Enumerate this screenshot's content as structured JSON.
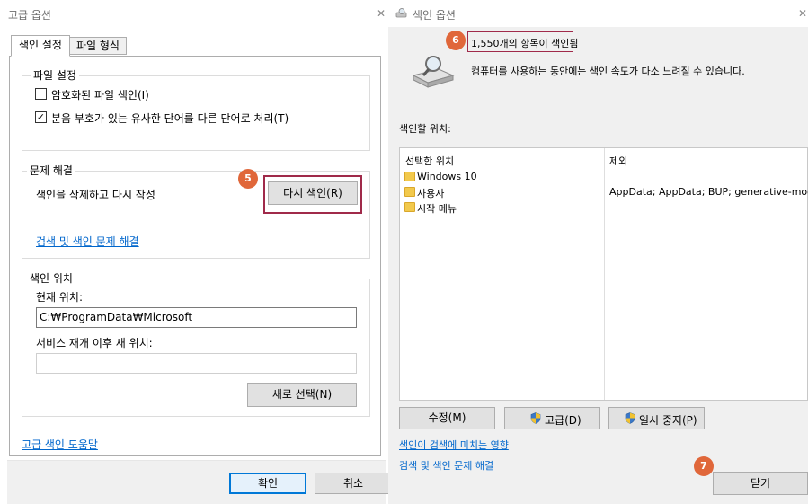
{
  "left": {
    "title": "고급 옵션",
    "tabs": [
      {
        "label": "색인 설정"
      },
      {
        "label": "파일 형식"
      }
    ],
    "file_settings": {
      "legend": "파일 설정",
      "options": [
        {
          "label": "암호화된 파일 색인(I)",
          "checked": false
        },
        {
          "label": "분음 부호가 있는 유사한 단어를 다른 단어로 처리(T)",
          "checked": true
        }
      ]
    },
    "troubleshooting": {
      "legend": "문제 해결",
      "rebuild_text": "색인을 삭제하고 다시 작성",
      "rebuild_button": "다시 색인(R)",
      "link": "검색 및 색인 문제 해결"
    },
    "index_location": {
      "legend": "색인 위치",
      "current_label": "현재 위치:",
      "current_value": "C:₩ProgramData₩Microsoft",
      "new_label": "서비스 재개 이후 새 위치:",
      "new_value": "",
      "select_button": "새로 선택(N)"
    },
    "help_link": "고급 색인 도움말",
    "ok_button": "확인",
    "cancel_button": "취소",
    "callout": "5"
  },
  "right": {
    "title": "색인 옵션",
    "status": "1,550개의 항목이 색인됨",
    "status_note": "컴퓨터를 사용하는 동안에는 색인 속도가 다소 느려질 수 있습니다.",
    "locations_label": "색인할 위치:",
    "col_included": "선택한 위치",
    "col_excluded": "제외",
    "locations": [
      {
        "name": "Windows 10"
      },
      {
        "name": "사용자"
      },
      {
        "name": "시작 메뉴"
      }
    ],
    "exclusions": [
      {
        "text": ""
      },
      {
        "text": "AppData; AppData; BUP; generative-models"
      },
      {
        "text": ""
      }
    ],
    "modify_button": "수정(M)",
    "advanced_button": "고급(D)",
    "pause_button": "일시 중지(P)",
    "link_effect": "색인이 검색에 미치는 영향",
    "link_troubleshoot": "검색 및 색인 문제 해결",
    "close_button": "닫기",
    "callouts": [
      "6",
      "7"
    ]
  },
  "colors": {
    "highlight": "#a02a4a",
    "callout": "#e0673a",
    "link": "#0066cc",
    "default_button_border": "#0078d7"
  },
  "icons": {
    "close": "close-icon",
    "folder": "folder-icon",
    "shield": "shield-icon",
    "drive_search": "drive-search-icon"
  }
}
